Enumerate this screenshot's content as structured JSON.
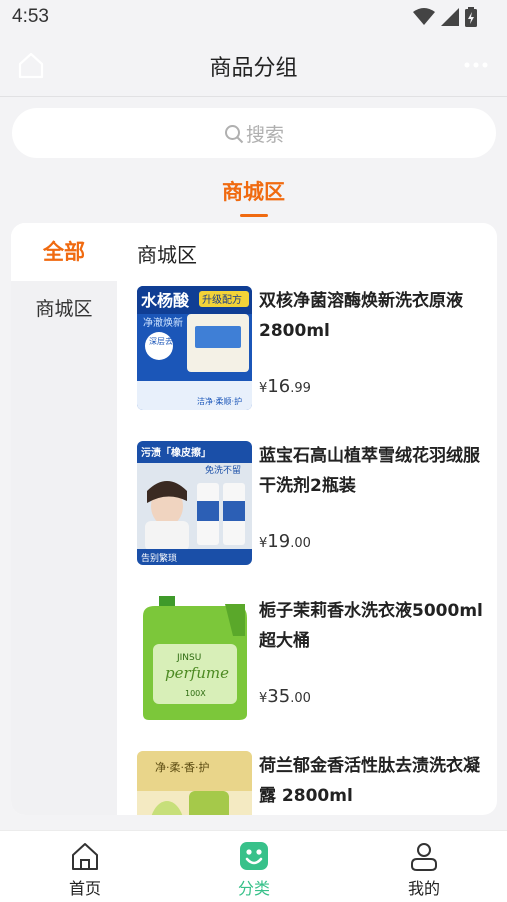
{
  "status": {
    "time": "4:53"
  },
  "header": {
    "title": "商品分组"
  },
  "search": {
    "placeholder": "搜索"
  },
  "topic_tab": {
    "label": "商城区"
  },
  "categories": {
    "all_label": "全部",
    "items": [
      {
        "label": "商城区"
      }
    ]
  },
  "section": {
    "title": "商城区"
  },
  "products": [
    {
      "name": "双核净菌溶酶焕新洗衣原液2800ml",
      "currency": "¥",
      "price_int": "16",
      "price_dec": ".99",
      "image_text": {
        "headline": "水杨酸",
        "badge": "升级配方",
        "sub": "净澈焕新",
        "tag": "深层去渍",
        "bottom": "洁净·柔顺·护"
      }
    },
    {
      "name": "蓝宝石高山植萃雪绒花羽绒服干洗剂2瓶装",
      "currency": "¥",
      "price_int": "19",
      "price_dec": ".00",
      "image_text": {
        "headline": "污渍「橡皮擦」",
        "badge": "免洗不留",
        "bottom": "告别繁琐"
      }
    },
    {
      "name": "栀子茉莉香水洗衣液5000ml 超大桶",
      "currency": "¥",
      "price_int": "35",
      "price_dec": ".00",
      "image_text": {
        "brand": "JINSU",
        "script": "perfume",
        "sub": "100X"
      }
    },
    {
      "name": "荷兰郁金香活性肽去渍洗衣凝露 2800ml",
      "currency": "¥",
      "price_int": "",
      "price_dec": "",
      "image_text": {
        "headline": "净·柔·香·护"
      }
    }
  ],
  "tabbar": {
    "items": [
      {
        "label": "首页"
      },
      {
        "label": "分类"
      },
      {
        "label": "我的"
      }
    ]
  },
  "colors": {
    "accent": "#f06a10",
    "active_tab": "#38c18a",
    "background": "#f3f3f5"
  }
}
